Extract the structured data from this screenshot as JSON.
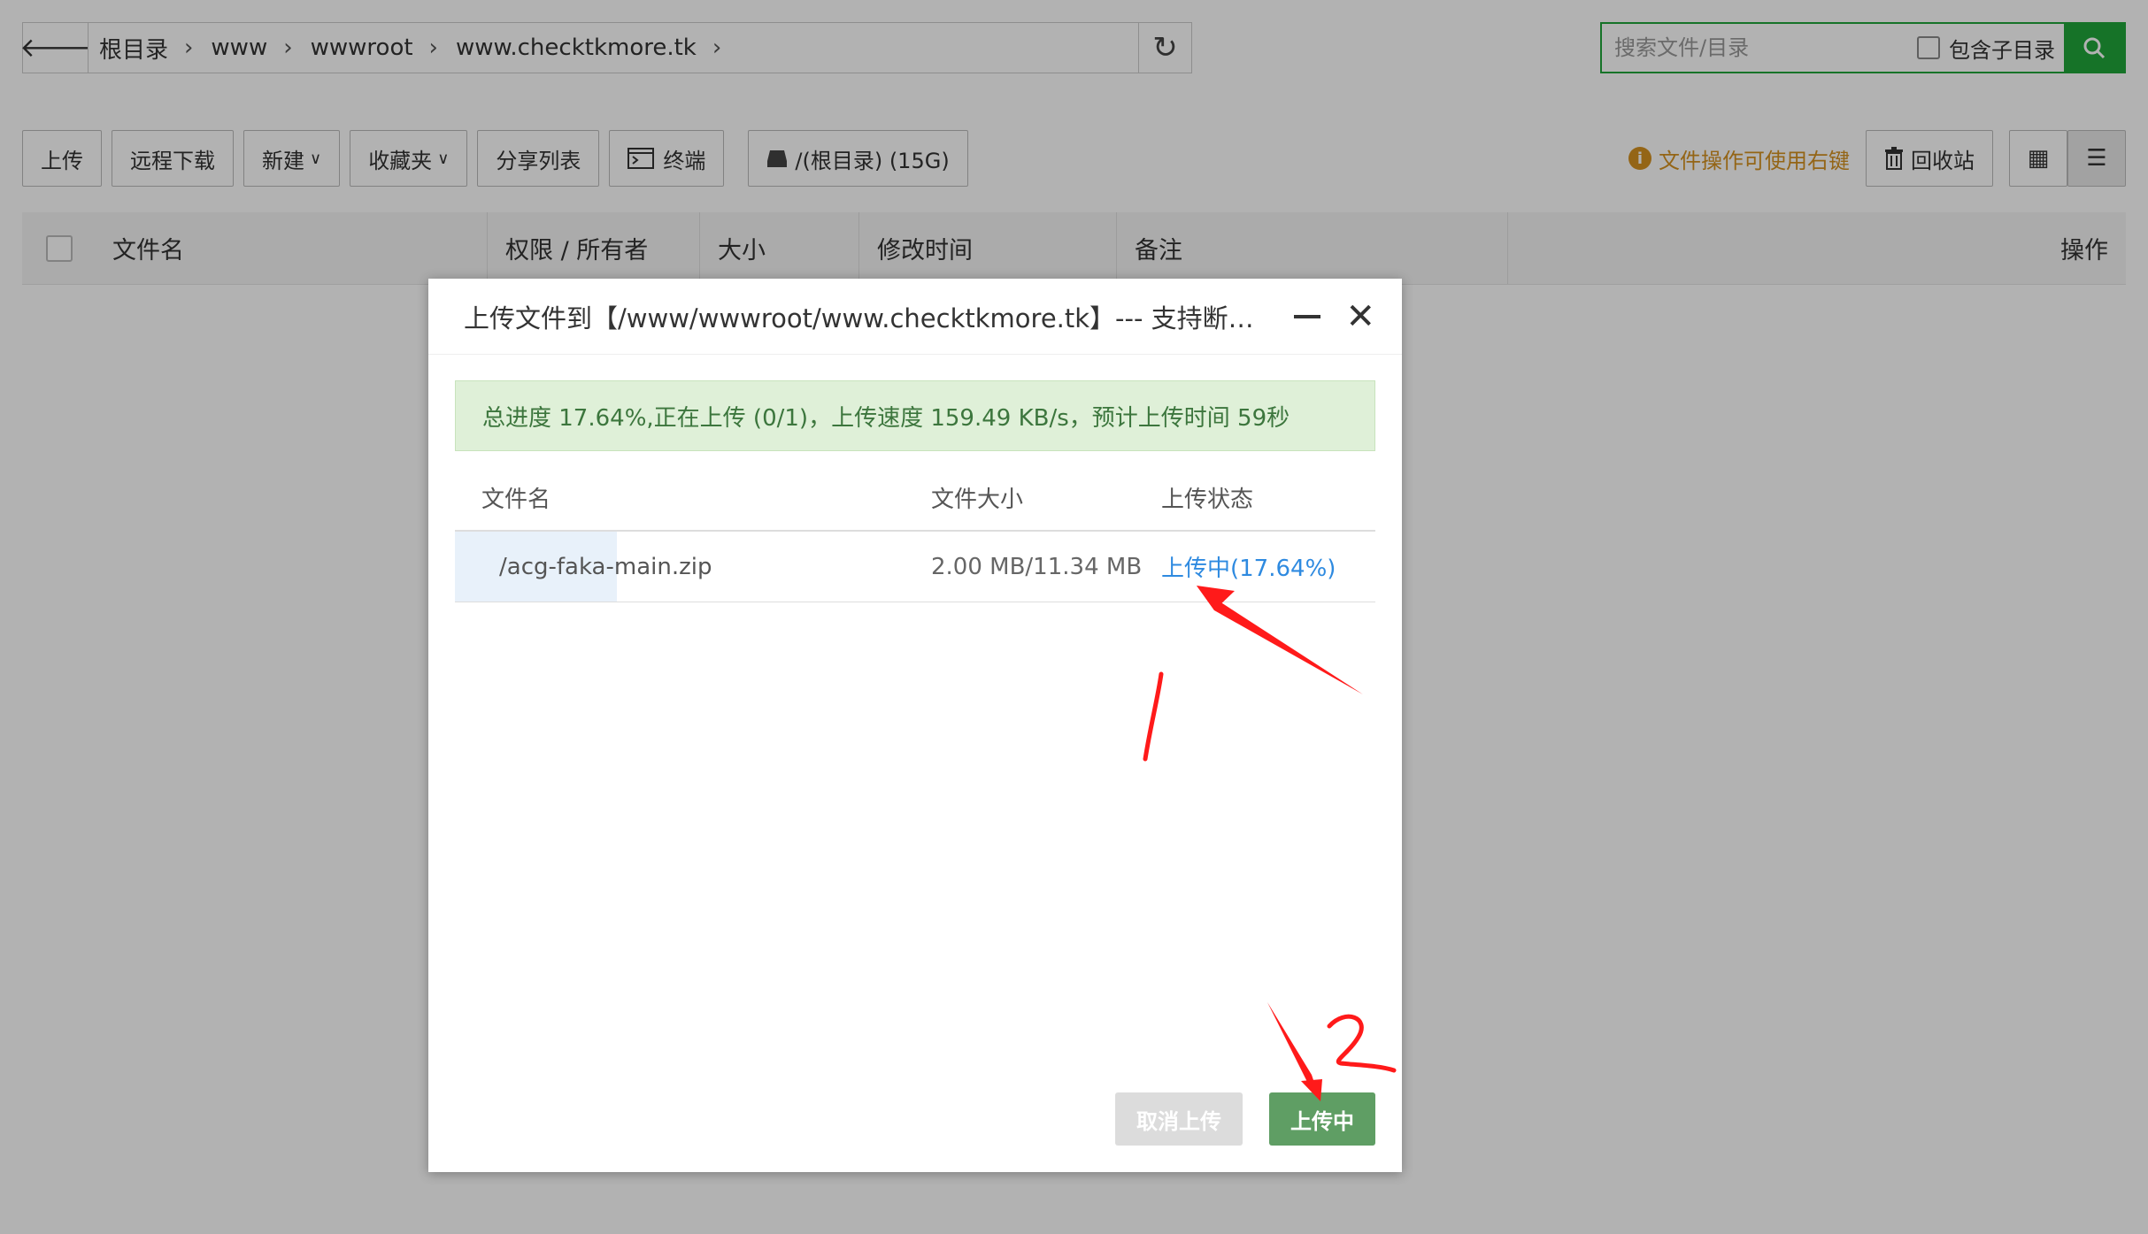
{
  "pathbar": {
    "back_icon": "arrow-left-icon",
    "crumbs": [
      "根目录",
      "www",
      "wwwroot",
      "www.checktkmore.tk"
    ],
    "separator": "›",
    "refresh_icon": "refresh-icon"
  },
  "search": {
    "placeholder": "搜索文件/目录",
    "include_sub_label": "包含子目录",
    "search_icon": "search-icon"
  },
  "toolbar": {
    "upload": "上传",
    "remote_download": "远程下载",
    "new": "新建",
    "favorites": "收藏夹",
    "share_list": "分享列表",
    "terminal": "终端",
    "disk": "/(根目录) (15G)",
    "tip": "文件操作可使用右键",
    "recycle": "回收站"
  },
  "table_header": {
    "name": "文件名",
    "perm": "权限 / 所有者",
    "size": "大小",
    "mtime": "修改时间",
    "remark": "备注",
    "actions": "操作"
  },
  "dialog": {
    "title": "上传文件到【/www/wwwroot/www.checktkmore.tk】--- 支持断点...",
    "progress_text": "总进度 17.64%,正在上传 (0/1)，上传速度 159.49 KB/s，预计上传时间 59秒",
    "columns": {
      "name": "文件名",
      "size": "文件大小",
      "status": "上传状态"
    },
    "files": [
      {
        "name": "/acg-faka-main.zip",
        "size": "2.00 MB/11.34 MB",
        "status": "上传中(17.64%)",
        "progress": 0.1764
      }
    ],
    "cancel_label": "取消上传",
    "uploading_label": "上传中"
  },
  "colors": {
    "accent_green": "#20a53a",
    "progress_bg": "#dff0d8",
    "progress_text": "#3c763d",
    "link_blue": "#2e8ae0",
    "tip_orange": "#d49120",
    "annotation_red": "#ff1a1a"
  }
}
